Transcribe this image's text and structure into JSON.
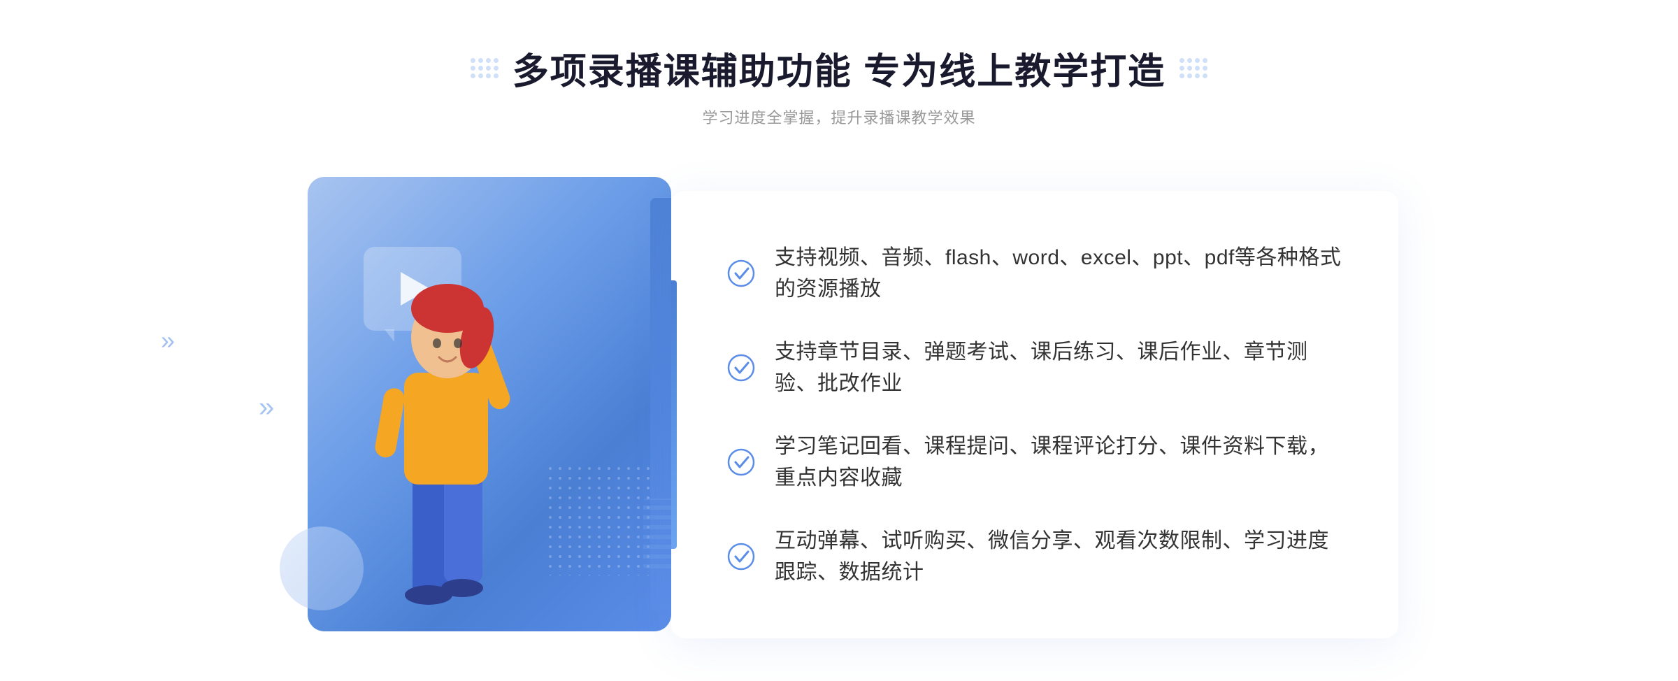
{
  "header": {
    "main_title": "多项录播课辅助功能 专为线上教学打造",
    "sub_title": "学习进度全掌握，提升录播课教学效果"
  },
  "features": [
    {
      "id": 1,
      "text": "支持视频、音频、flash、word、excel、ppt、pdf等各种格式的资源播放"
    },
    {
      "id": 2,
      "text": "支持章节目录、弹题考试、课后练习、课后作业、章节测验、批改作业"
    },
    {
      "id": 3,
      "text": "学习笔记回看、课程提问、课程评论打分、课件资料下载，重点内容收藏"
    },
    {
      "id": 4,
      "text": "互动弹幕、试听购买、微信分享、观看次数限制、学习进度跟踪、数据统计"
    }
  ],
  "decorative": {
    "arrows_left": "»",
    "arrows_page_left": "»"
  }
}
